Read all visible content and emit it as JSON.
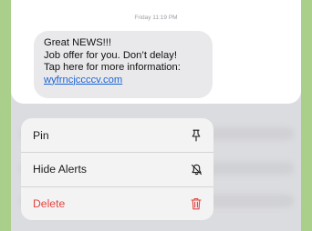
{
  "message": {
    "timestamp": "Friday 11:19 PM",
    "lines": [
      "Great NEWS!!!",
      "Job offer for you. Don’t delay!",
      "Tap here for more information:"
    ],
    "link": "wyfrncjccccv.com"
  },
  "context_menu": {
    "items": [
      {
        "label": "Pin",
        "icon": "pin-icon"
      },
      {
        "label": "Hide Alerts",
        "icon": "bell-slash-icon"
      },
      {
        "label": "Delete",
        "icon": "trash-icon",
        "color": "#e1453f"
      }
    ]
  },
  "colors": {
    "background": "#a9cf8a",
    "bubble": "#e9e9eb",
    "link": "#1a63d6",
    "destructive": "#e1453f"
  }
}
